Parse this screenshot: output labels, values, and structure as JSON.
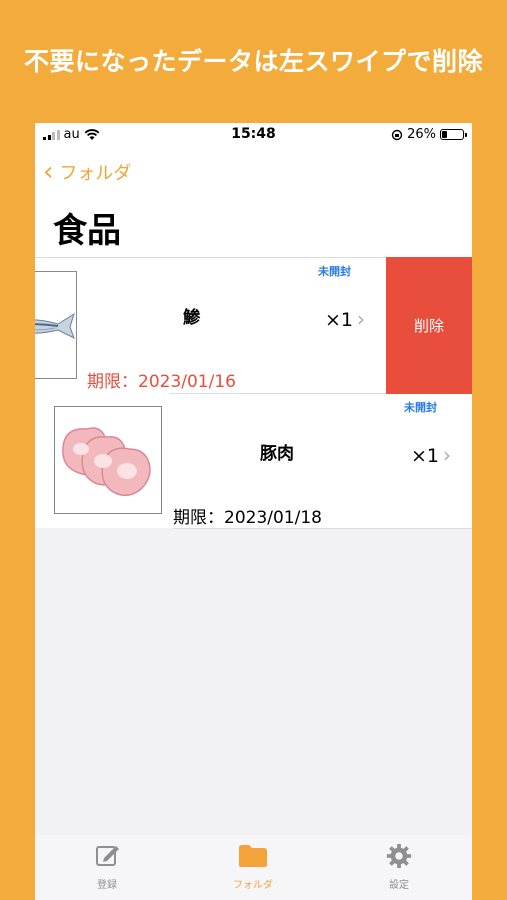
{
  "banner": "不要になったデータは左スワイプで削除",
  "status": {
    "carrier": "au",
    "time": "15:48",
    "battery": "26%"
  },
  "nav": {
    "back_label": "フォルダ",
    "title": "食品"
  },
  "items": [
    {
      "name": "鯵",
      "qty": "×1",
      "badge": "未開封",
      "expiry": "期限：2023/01/16",
      "expiry_color": "#e94d3c"
    },
    {
      "name": "豚肉",
      "qty": "×1",
      "badge": "未開封",
      "expiry": "期限：2023/01/18",
      "expiry_color": "#000000"
    }
  ],
  "delete_label": "削除",
  "tabs": [
    {
      "label": "登録",
      "icon": "edit-icon"
    },
    {
      "label": "フォルダ",
      "icon": "folder-icon",
      "active": true
    },
    {
      "label": "設定",
      "icon": "gear-icon"
    }
  ],
  "colors": {
    "accent": "#f3a339",
    "delete": "#e94d3c",
    "badge": "#2a7be5",
    "background": "#f3ac3c"
  }
}
